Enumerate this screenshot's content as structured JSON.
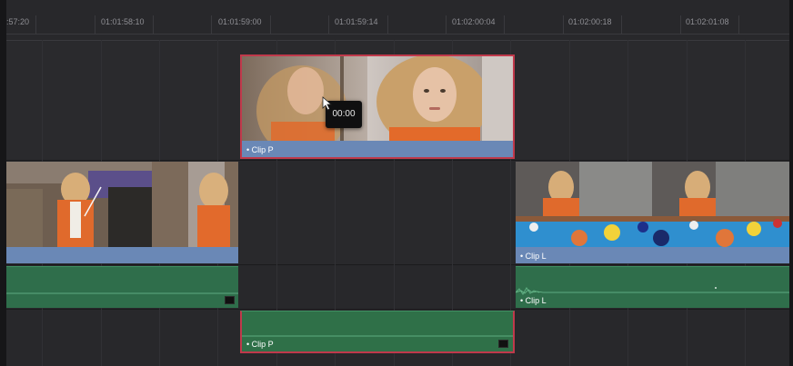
{
  "timeline": {
    "ruler": {
      "timecodes": [
        ":57:20",
        "01:01:58:10",
        "01:01:59:00",
        "01:01:59:14",
        "01:02:00:04",
        "01:02:00:18",
        "01:02:01:08"
      ]
    },
    "tracks": {
      "video_upper": {
        "clip": {
          "label": "Clip P",
          "selected": true
        }
      },
      "video_main": {
        "clips": [
          {
            "label": "",
            "selected": false
          },
          {
            "label": "Clip L",
            "selected": false
          }
        ]
      },
      "audio_main": {
        "clips": [
          {
            "label": "",
            "selected": false
          },
          {
            "label": "Clip L",
            "selected": false
          }
        ]
      },
      "audio_lower": {
        "clip": {
          "label": "Clip P",
          "selected": true
        }
      }
    },
    "tooltip": {
      "text": "00:00"
    }
  },
  "colors": {
    "selection": "#c0394b",
    "video_clip": "#5b7aa6",
    "audio_clip": "#2f6e4b",
    "background": "#2a2a2d"
  },
  "icons": [
    "mouse-pointer-icon",
    "audio-waveform-icon",
    "audio-clip-badge-icon",
    "trim-handle-icon"
  ]
}
